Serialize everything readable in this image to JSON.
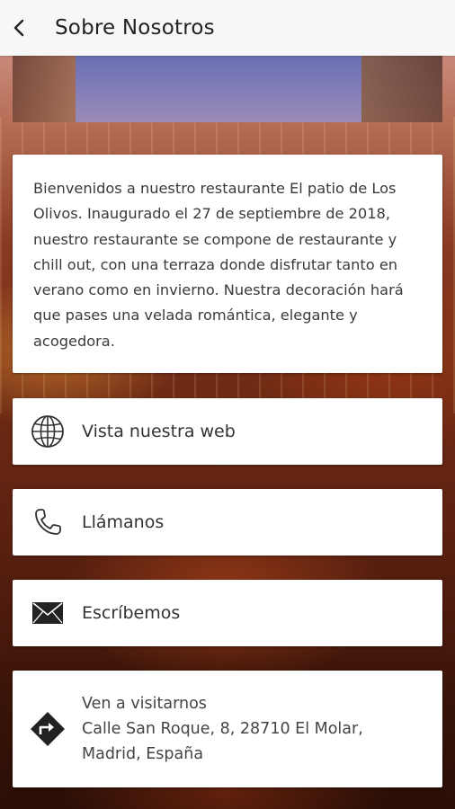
{
  "app_bar": {
    "title": "Sobre Nosotros",
    "back_icon": "chevron-left-icon"
  },
  "intro": {
    "text": "Bienvenidos a nuestro restaurante El patio de Los Olivos. Inaugurado el 27 de septiembre de 2018, nuestro restaurante se compone de restaurante y chill out, con una terraza donde disfrutar tanto en verano como en invierno. Nuestra decoración hará que pases una velada romántica, elegante y acogedora."
  },
  "actions": {
    "web": {
      "label": "Vista nuestra web",
      "icon": "globe-icon"
    },
    "call": {
      "label": "Llámanos",
      "icon": "phone-icon"
    },
    "mail": {
      "label": "Escríbemos",
      "icon": "envelope-icon"
    }
  },
  "visit": {
    "title": "Ven a visitarnos",
    "address": "Calle San Roque, 8, 28710 El Molar, Madrid, España",
    "icon": "directions-icon"
  },
  "colors": {
    "app_bar_bg": "#f7f7f7",
    "card_bg": "#ffffff",
    "text": "#333333"
  }
}
